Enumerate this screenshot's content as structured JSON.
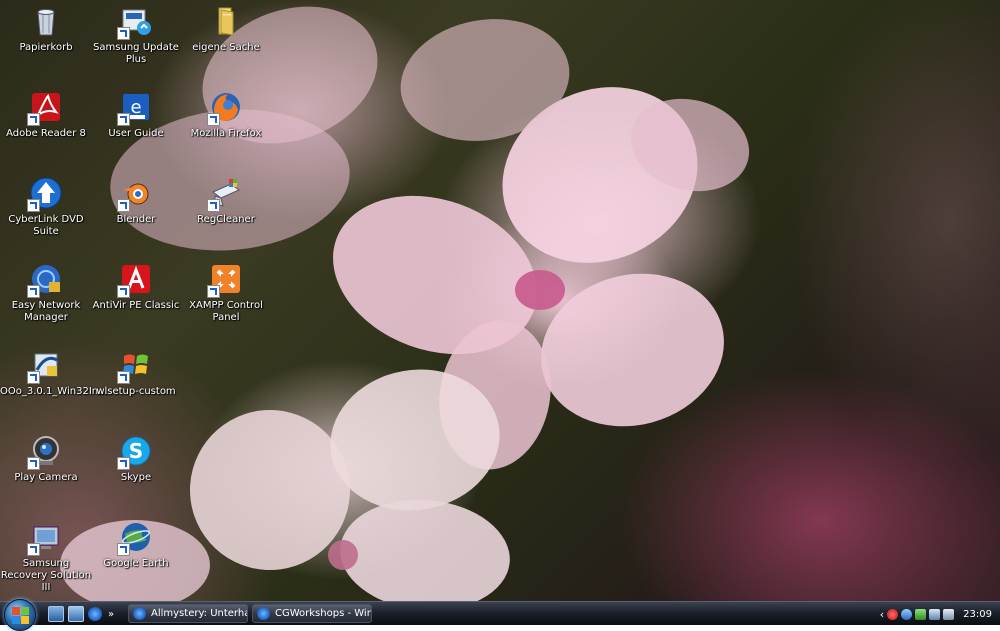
{
  "desktop": {
    "icons": [
      {
        "label": "Papierkorb",
        "icon": "recycle-bin-icon"
      },
      {
        "label": "Samsung Update Plus",
        "icon": "samsung-update-icon"
      },
      {
        "label": "eigene Sache",
        "icon": "folder-icon"
      },
      {
        "label": "Adobe Reader 8",
        "icon": "adobe-reader-icon"
      },
      {
        "label": "User Guide",
        "icon": "user-guide-icon"
      },
      {
        "label": "Mozilla Firefox",
        "icon": "firefox-icon"
      },
      {
        "label": "CyberLink DVD Suite",
        "icon": "cyberlink-icon"
      },
      {
        "label": "Blender",
        "icon": "blender-icon"
      },
      {
        "label": "RegCleaner",
        "icon": "regcleaner-icon"
      },
      {
        "label": "Easy Network Manager",
        "icon": "network-manager-icon"
      },
      {
        "label": "AntiVir PE Classic",
        "icon": "antivir-icon"
      },
      {
        "label": "XAMPP Control Panel",
        "icon": "xampp-icon"
      },
      {
        "label": "OOo_3.0.1_Win32In...",
        "icon": "openoffice-installer-icon"
      },
      {
        "label": "wlsetup-custom",
        "icon": "windows-live-icon"
      },
      {
        "label": "Play Camera",
        "icon": "camera-icon"
      },
      {
        "label": "Skype",
        "icon": "skype-icon"
      },
      {
        "label": "Samsung Recovery Solution III",
        "icon": "recovery-icon"
      },
      {
        "label": "Google Earth",
        "icon": "google-earth-icon"
      }
    ]
  },
  "taskbar": {
    "tasks": [
      {
        "label": "Allmystery: Unterhal..."
      },
      {
        "label": "CGWorkshops - Win..."
      }
    ],
    "clock": "23:09",
    "tray_chevron": "‹",
    "quicklaunch_chevron": "»"
  },
  "colors": {
    "taskbar": "#1a1e28",
    "start_orb": "#2e6fb0",
    "label_text": "#ffffff"
  }
}
